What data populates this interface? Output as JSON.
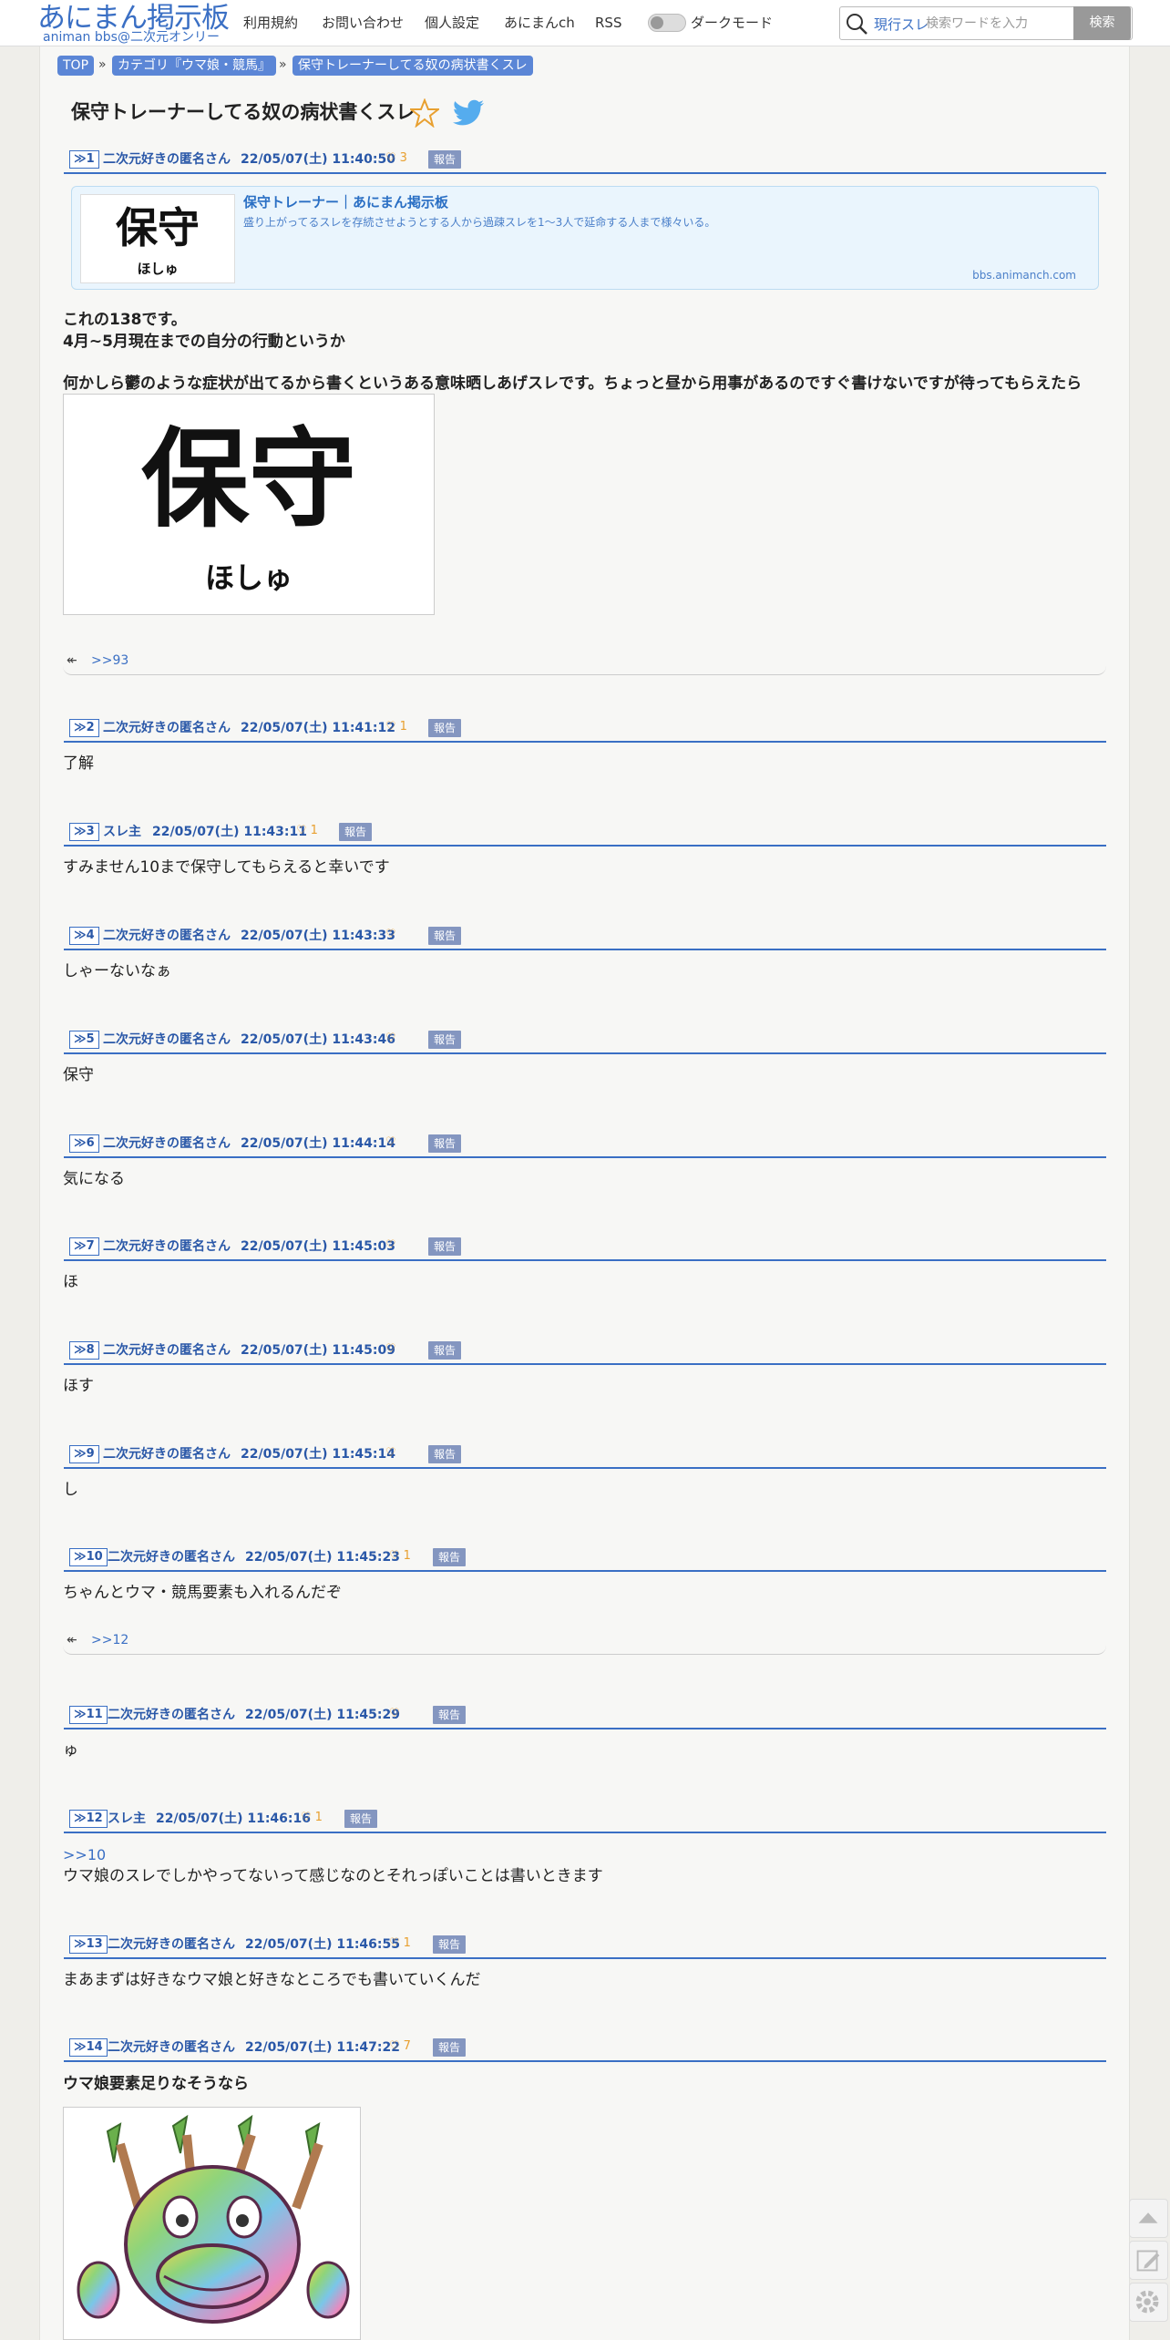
{
  "header": {
    "logo_title": "あにまん掲示板",
    "logo_subtitle": "animan bbs@二次元オンリー",
    "nav": [
      "利用規約",
      "お問い合わせ",
      "個人設定",
      "あにまんch",
      "RSS"
    ],
    "dark_mode_label": "ダークモード",
    "search_scope": "現行スレ",
    "search_placeholder": "検索ワードを入力",
    "search_button": "検索"
  },
  "breadcrumb": [
    "TOP",
    "カテゴリ『ウマ娘・競馬』",
    "保守トレーナーしてる奴の病状書くスレ"
  ],
  "breadcrumb_sep": "»",
  "thread": {
    "title": "保守トレーナーしてる奴の病状書くスレ",
    "report_label": "報告",
    "like_icon": "♡",
    "posts": [
      {
        "num": "1",
        "name": "二次元好きの匿名さん",
        "date": "22/05/07(土) 11:40:50",
        "likes": "3",
        "body": [
          "これの138です。",
          "4月~5月現在までの自分の行動というか",
          "何かしら鬱のような症状が出てるから書くというある意味晒しあげスレです。ちょっと昼から用事があるのですぐ書けないですが待ってもらえたら"
        ],
        "replies": ">>93"
      },
      {
        "num": "2",
        "name": "二次元好きの匿名さん",
        "date": "22/05/07(土) 11:41:12",
        "likes": "1",
        "body": [
          "了解"
        ]
      },
      {
        "num": "3",
        "name": "スレ主",
        "date": "22/05/07(土) 11:43:11",
        "likes": "1",
        "body": [
          "すみません10まで保守してもらえると幸いです"
        ]
      },
      {
        "num": "4",
        "name": "二次元好きの匿名さん",
        "date": "22/05/07(土) 11:43:33",
        "likes": "",
        "body": [
          "しゃーないなぁ"
        ]
      },
      {
        "num": "5",
        "name": "二次元好きの匿名さん",
        "date": "22/05/07(土) 11:43:46",
        "likes": "",
        "body": [
          "保守"
        ]
      },
      {
        "num": "6",
        "name": "二次元好きの匿名さん",
        "date": "22/05/07(土) 11:44:14",
        "likes": "",
        "body": [
          "気になる"
        ]
      },
      {
        "num": "7",
        "name": "二次元好きの匿名さん",
        "date": "22/05/07(土) 11:45:03",
        "likes": "",
        "body": [
          "ほ"
        ]
      },
      {
        "num": "8",
        "name": "二次元好きの匿名さん",
        "date": "22/05/07(土) 11:45:09",
        "likes": "",
        "body": [
          "ほす"
        ]
      },
      {
        "num": "9",
        "name": "二次元好きの匿名さん",
        "date": "22/05/07(土) 11:45:14",
        "likes": "",
        "body": [
          "し"
        ]
      },
      {
        "num": "10",
        "name": "二次元好きの匿名さん",
        "date": "22/05/07(土) 11:45:23",
        "likes": "1",
        "body": [
          "ちゃんとウマ・競馬要素も入れるんだぞ"
        ],
        "replies": ">>12"
      },
      {
        "num": "11",
        "name": "二次元好きの匿名さん",
        "date": "22/05/07(土) 11:45:29",
        "likes": "",
        "body": [
          "ゅ"
        ]
      },
      {
        "num": "12",
        "name": "スレ主",
        "date": "22/05/07(土) 11:46:16",
        "likes": "1",
        "anchor": ">>10",
        "body": [
          "ウマ娘のスレでしかやってないって感じなのとそれっぽいことは書いときます"
        ]
      },
      {
        "num": "13",
        "name": "二次元好きの匿名さん",
        "date": "22/05/07(土) 11:46:55",
        "likes": "1",
        "body": [
          "まあまずは好きなウマ娘と好きなところでも書いていくんだ"
        ]
      },
      {
        "num": "14",
        "name": "二次元好きの匿名さん",
        "date": "22/05/07(土) 11:47:22",
        "likes": "7",
        "body": [
          "ウマ娘要素足りなそうなら"
        ]
      }
    ]
  },
  "linkcard": {
    "title": "保守トレーナー｜あにまん掲示板",
    "desc": "盛り上がってるスレを存続させようとする人から過疎スレを1〜3人で延命する人まで様々いる。",
    "domain": "bbs.animanch.com"
  },
  "hoshu_image": {
    "big": "保守",
    "small": "ほしゅ"
  },
  "colors": {
    "accent": "#3a6fc4",
    "report": "#8496c0",
    "like": "#e8a030",
    "crumb": "#5b86d6"
  }
}
